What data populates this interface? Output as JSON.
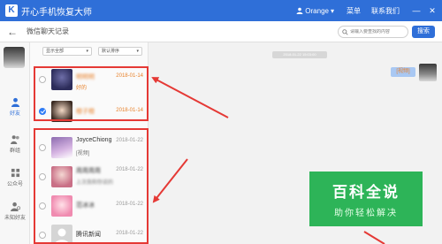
{
  "titlebar": {
    "logo_letter": "K",
    "app_title": "开心手机恢复大师",
    "user_name": "Orange",
    "menu": "菜单",
    "contact": "联系我们",
    "minimize": "—",
    "close": "✕"
  },
  "toolbar": {
    "back": "←",
    "page_title": "微信聊天记录",
    "search_placeholder": "请输入要查找的内容",
    "search_button": "搜索"
  },
  "sidebar": {
    "items": [
      {
        "label": "好友",
        "icon": "person-icon",
        "active": true
      },
      {
        "label": "群组",
        "icon": "group-icon",
        "active": false
      },
      {
        "label": "公众号",
        "icon": "official-account-icon",
        "active": false
      },
      {
        "label": "未知好友",
        "icon": "unknown-friend-icon",
        "active": false
      }
    ]
  },
  "filters": {
    "show": "显示全部",
    "sort": "默认排序"
  },
  "contacts": [
    {
      "name": "明明明",
      "date": "2018-01-14",
      "preview": "好的",
      "highlight": true,
      "checked": false,
      "blurred": true
    },
    {
      "name": "橙子橙",
      "date": "2018-01-14",
      "preview": "",
      "highlight": true,
      "checked": true,
      "blurred": true
    },
    {
      "name": "JoyceChiong",
      "date": "2018-01-22",
      "preview": "[视频]",
      "highlight": false,
      "checked": false,
      "blurred": false
    },
    {
      "name": "周周周周",
      "date": "2018-01-22",
      "preview": "上次我和你说的",
      "highlight": false,
      "checked": false,
      "blurred": true
    },
    {
      "name": "范冰冰",
      "date": "2018-01-22",
      "preview": "",
      "highlight": false,
      "checked": false,
      "blurred": true
    },
    {
      "name": "腾讯新闻",
      "date": "2018-01-22",
      "preview": "",
      "highlight": false,
      "checked": false,
      "blurred": false
    }
  ],
  "chat": {
    "timestamp": "2018-01-22 15:03:00",
    "bubble": "[视频]"
  },
  "watermark": {
    "title": "百科全说",
    "subtitle": "助你轻松解决"
  },
  "colors": {
    "brand": "#2f6fd8",
    "annotation": "#e53935",
    "highlight_text": "#e8812a",
    "watermark": "#1caf4b"
  }
}
